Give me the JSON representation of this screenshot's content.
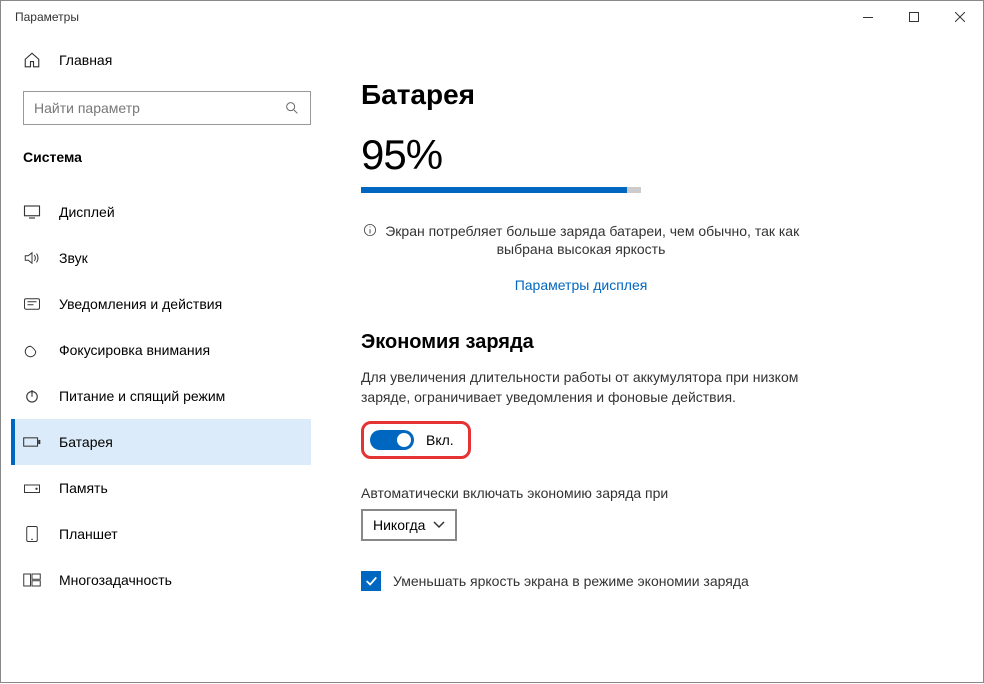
{
  "titlebar": {
    "title": "Параметры"
  },
  "sidebar": {
    "home": "Главная",
    "search_placeholder": "Найти параметр",
    "section": "Система",
    "items": [
      {
        "label": "Дисплей"
      },
      {
        "label": "Звук"
      },
      {
        "label": "Уведомления и действия"
      },
      {
        "label": "Фокусировка внимания"
      },
      {
        "label": "Питание и спящий режим"
      },
      {
        "label": "Батарея"
      },
      {
        "label": "Память"
      },
      {
        "label": "Планшет"
      },
      {
        "label": "Многозадачность"
      }
    ]
  },
  "content": {
    "title": "Батарея",
    "percent": "95%",
    "progress_pct": 95,
    "info_text": "Экран потребляет больше заряда батареи, чем обычно, так как выбрана высокая яркость",
    "link": "Параметры дисплея",
    "saver_heading": "Экономия заряда",
    "saver_desc": "Для увеличения длительности работы от аккумулятора при низком заряде, ограничивает уведомления и фоновые действия.",
    "toggle_label": "Вкл.",
    "auto_label": "Автоматически включать экономию заряда при",
    "auto_select": "Никогда",
    "checkbox_label": "Уменьшать яркость экрана в режиме экономии заряда"
  }
}
